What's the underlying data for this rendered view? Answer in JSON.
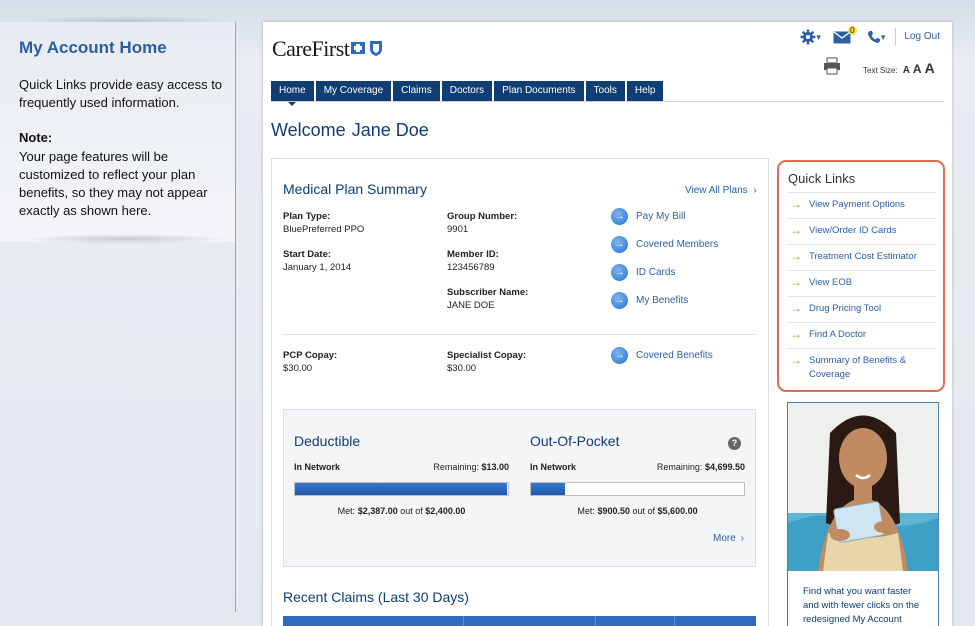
{
  "left_panel": {
    "title": "My Account Home",
    "intro": "Quick Links provide easy access to frequently used information.",
    "note_title": "Note:",
    "note_text": "Your page features will be customized to reflect your plan benefits, so they may not appear exactly as shown here."
  },
  "header": {
    "logo_text": "CareFirst",
    "mail_badge": "0",
    "logout": "Log Out",
    "text_size_label": "Text Size:",
    "text_size_options": [
      "A",
      "A",
      "A"
    ]
  },
  "nav": {
    "tabs": [
      "Home",
      "My Coverage",
      "Claims",
      "Doctors",
      "Plan Documents",
      "Tools",
      "Help"
    ],
    "active": "Home"
  },
  "welcome": {
    "greeting": "Welcome",
    "name": "Jane Doe"
  },
  "plan_summary": {
    "title": "Medical Plan Summary",
    "view_all": "View All Plans",
    "fields": {
      "plan_type": {
        "label": "Plan Type:",
        "value": "BluePreferred PPO"
      },
      "start_date": {
        "label": "Start Date:",
        "value": "January 1, 2014"
      },
      "group_number": {
        "label": "Group Number:",
        "value": "9901"
      },
      "member_id": {
        "label": "Member ID:",
        "value": "123456789"
      },
      "subscriber_name": {
        "label": "Subscriber Name:",
        "value": "JANE DOE"
      },
      "pcp_copay": {
        "label": "PCP Copay:",
        "value": "$30.00"
      },
      "specialist_copay": {
        "label": "Specialist Copay:",
        "value": "$30.00"
      }
    },
    "actions": [
      "Pay My Bill",
      "Covered Members",
      "ID Cards",
      "My Benefits"
    ],
    "covered_benefits": "Covered Benefits"
  },
  "deductible": {
    "title": "Deductible",
    "network": "In Network",
    "remaining_label": "Remaining:",
    "remaining": "$13.00",
    "met_label": "Met:",
    "met": "$2,387.00",
    "out_of_label": "out of",
    "total": "$2,400.00",
    "progress_percent": 99.5
  },
  "out_of_pocket": {
    "title": "Out-Of-Pocket",
    "network": "In Network",
    "remaining_label": "Remaining:",
    "remaining": "$4,699.50",
    "met_label": "Met:",
    "met": "$900.50",
    "out_of_label": "out of",
    "total": "$5,600.00",
    "progress_percent": 16.1
  },
  "more_label": "More",
  "help_glyph": "?",
  "recent_claims": {
    "title": "Recent Claims (Last 30 Days)"
  },
  "quick_links": {
    "title": "Quick Links",
    "items": [
      "View Payment Options",
      "View/Order ID Cards",
      "Treatment Cost Estimator",
      "View EOB",
      "Drug Pricing Tool",
      "Find A Doctor",
      "Summary of Benefits & Coverage"
    ]
  },
  "promo": {
    "text": "Find what you want faster and with fewer clicks on the redesigned My Account"
  },
  "colors": {
    "navy": "#0f3d74",
    "link_blue": "#2e5fa3",
    "quick_links_border": "#e06b4e",
    "arrow_green": "#6db33f"
  },
  "icons": [
    "gear-icon",
    "mail-icon",
    "phone-icon",
    "print-icon",
    "chevron-right-icon",
    "arrow-right-icon",
    "help-icon"
  ]
}
